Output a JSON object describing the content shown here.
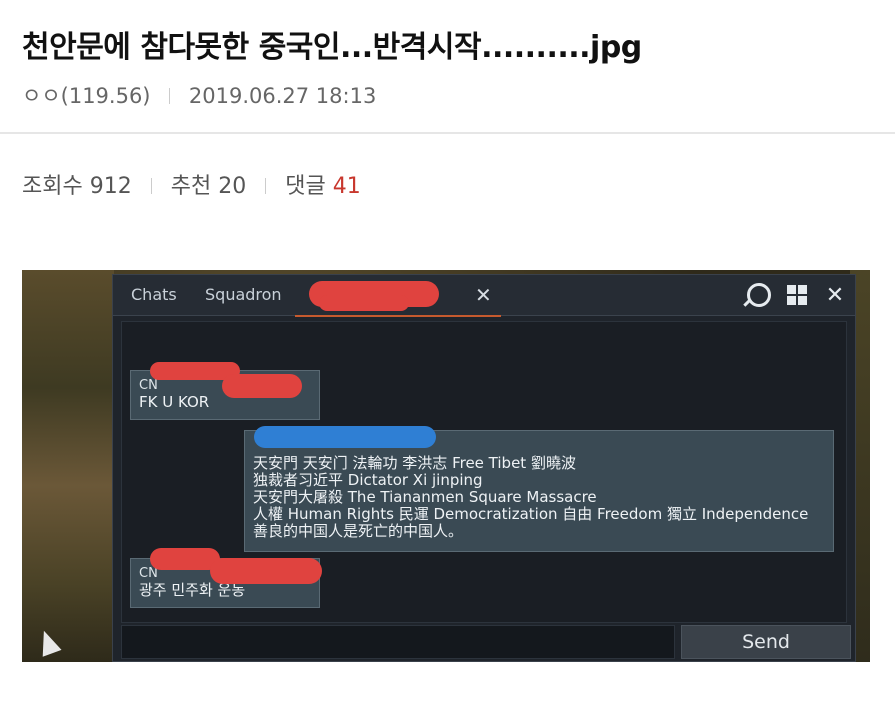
{
  "post": {
    "title": "천안문에 참다못한 중국인...반격시작..........jpg",
    "author": "ㅇㅇ(119.56)",
    "date": "2019.06.27 18:13"
  },
  "stats": {
    "views_label": "조회수",
    "views": "912",
    "recommend_label": "추천",
    "recommend": "20",
    "comments_label": "댓글",
    "comments": "41"
  },
  "colors": {
    "comment_count": "#c8372d",
    "active_tab": "#c65a2e"
  },
  "game_chat": {
    "tabs": [
      {
        "label": "Chats"
      },
      {
        "label": "Squadron"
      }
    ],
    "close_symbol": "✕",
    "icons": [
      "magnifier-icon",
      "grid-icon",
      "close-icon"
    ],
    "messages": [
      {
        "sender_prefix": "CN",
        "lines": [
          "FK U KOR"
        ]
      },
      {
        "lines": [
          "天安門 天安门 法輪功 李洪志 Free Tibet 劉曉波",
          "独裁者习近平 Dictator Xi jinping",
          "天安門大屠殺 The Tiananmen Square Massacre",
          "人權 Human Rights 民運 Democratization 自由 Freedom 獨立 Independence",
          "善良的中国人是死亡的中国人。"
        ]
      },
      {
        "sender_prefix": "CN",
        "lines": [
          "광주 민주화 운동"
        ]
      }
    ],
    "send_label": "Send"
  }
}
